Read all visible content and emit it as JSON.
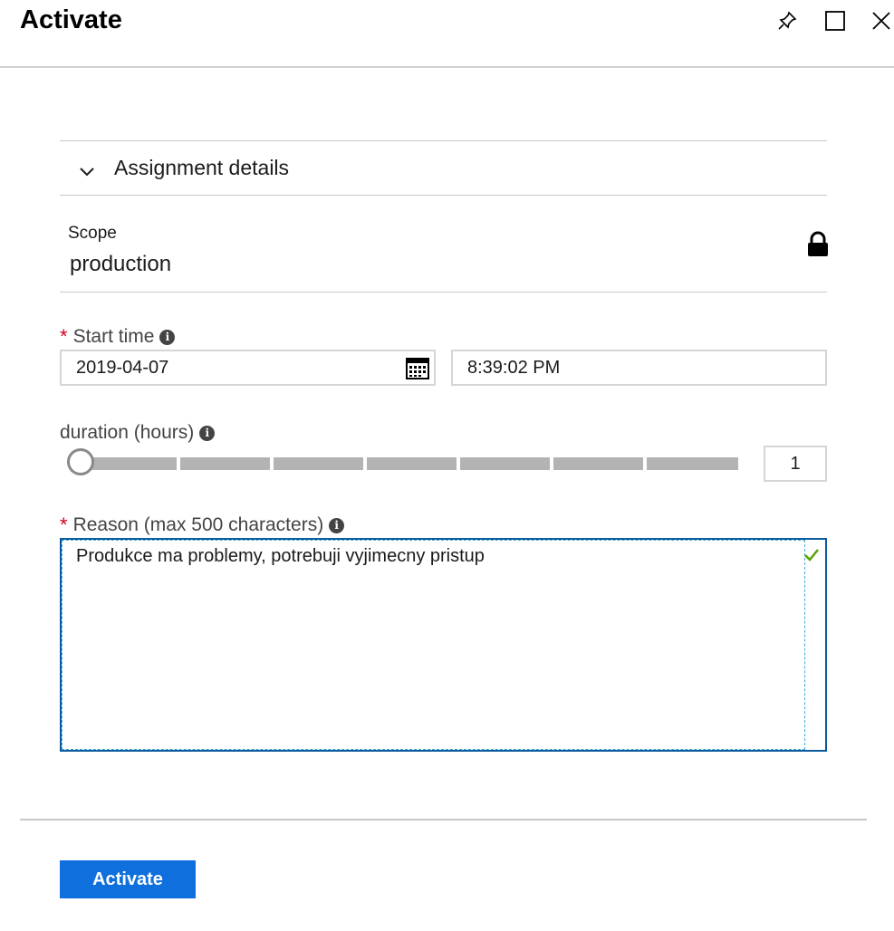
{
  "header": {
    "title": "Activate",
    "icons": [
      "pin-icon",
      "maximize-icon",
      "close-icon"
    ]
  },
  "section": {
    "title": "Assignment details",
    "expanded": true
  },
  "scope": {
    "label": "Scope",
    "value": "production"
  },
  "start_time": {
    "required_mark": "*",
    "label": "Start time",
    "info": "i",
    "date": "2019-04-07",
    "time": "8:39:02 PM"
  },
  "duration": {
    "label": "duration (hours)",
    "info": "i",
    "value": "1",
    "slider_min": 1,
    "slider_max": 8,
    "slider_value": 1
  },
  "reason": {
    "required_mark": "*",
    "label": "Reason (max 500 characters)",
    "info": "i",
    "value": "Produkce ma problemy, potrebuji vyjimecny pristup",
    "valid": true
  },
  "actions": {
    "activate_label": "Activate"
  },
  "colors": {
    "primary": "#0f6fdd",
    "required": "#d0021b",
    "valid": "#57a300",
    "focus_border": "#0a5a9c"
  }
}
